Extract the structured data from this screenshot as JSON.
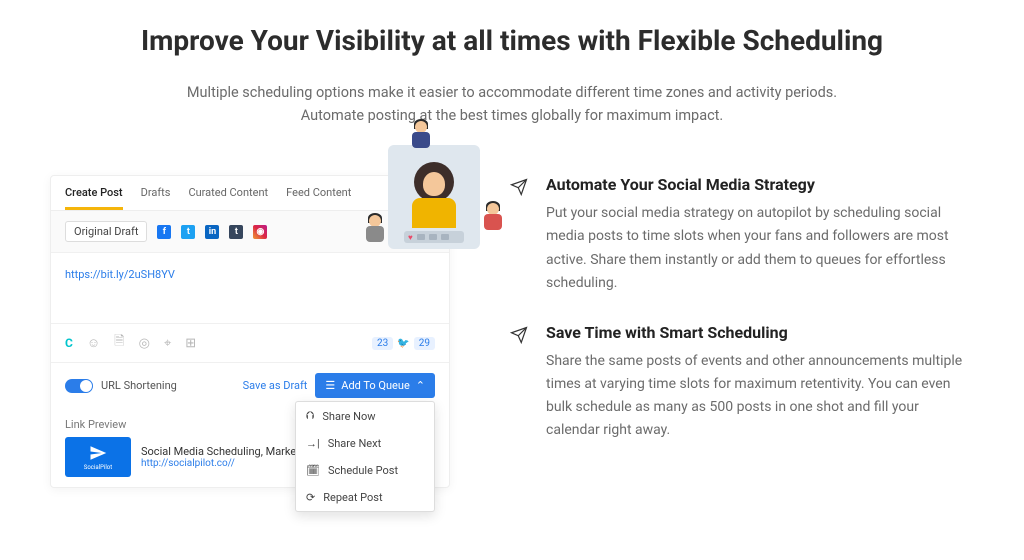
{
  "hero": {
    "title": "Improve Your Visibility at all times with Flexible Scheduling",
    "subtitle_line1": "Multiple scheduling options make it easier to accommodate different time zones and activity periods.",
    "subtitle_line2": "Automate posting at the best times globally for maximum impact."
  },
  "features": [
    {
      "title": "Automate Your Social Media Strategy",
      "body": "Put your social media strategy on autopilot by scheduling social media posts to time slots when your fans and followers are most active. Share them instantly or add them to queues for effortless scheduling."
    },
    {
      "title": "Save Time with Smart Scheduling",
      "body": "Share the same posts of events and other announcements multiple times at varying time slots for maximum retentivity. You can even bulk schedule as many as 500 posts in one shot and fill your calendar right away."
    }
  ],
  "app": {
    "tabs": [
      "Create Post",
      "Drafts",
      "Curated Content",
      "Feed Content"
    ],
    "draft_label": "Original Draft",
    "compose_url": "https://bit.ly/2uSH8YV",
    "counter_a": "23",
    "counter_b": "29",
    "toggle_label": "URL Shortening",
    "save_draft": "Save as Draft",
    "queue_btn": "Add To Queue",
    "dropdown": [
      "Share Now",
      "Share Next",
      "Schedule Post",
      "Repeat Post"
    ],
    "preview_label": "Link Preview",
    "preview_title": "Social Media Scheduling, Marketing and Analytics To",
    "preview_url": "http://socialpilot.co//",
    "thumb_brand": "SocialPilot"
  }
}
